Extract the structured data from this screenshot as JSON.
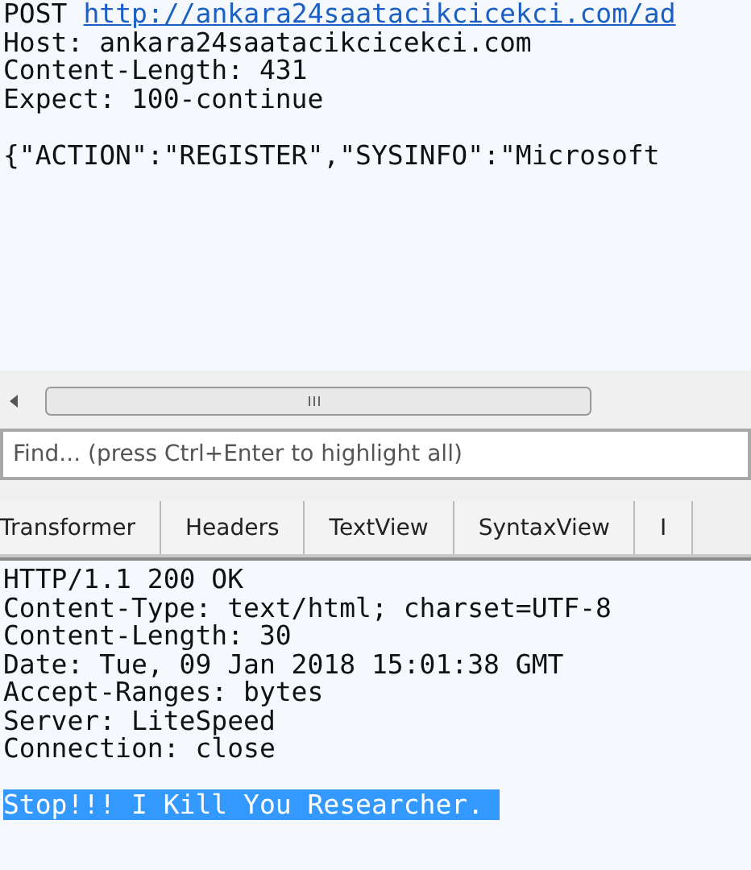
{
  "request": {
    "method": "POST",
    "url": "http://ankara24saatacikcicekci.com/ad",
    "headers": [
      "Host: ankara24saatacikcicekci.com",
      "Content-Length: 431",
      "Expect: 100-continue"
    ],
    "body": "{\"ACTION\":\"REGISTER\",\"SYSINFO\":\"Microsoft"
  },
  "find": {
    "placeholder": "Find... (press Ctrl+Enter to highlight all)"
  },
  "tabs": [
    {
      "label": "Transformer",
      "selected": false
    },
    {
      "label": "Headers",
      "selected": false
    },
    {
      "label": "TextView",
      "selected": false
    },
    {
      "label": "SyntaxView",
      "selected": false
    },
    {
      "label": "I",
      "selected": false
    }
  ],
  "response": {
    "headers": [
      "HTTP/1.1 200 OK",
      "Content-Type: text/html; charset=UTF-8",
      "Content-Length: 30",
      "Date: Tue, 09 Jan 2018 15:01:38 GMT",
      "Accept-Ranges: bytes",
      "Server: LiteSpeed",
      "Connection: close"
    ],
    "body": {
      "text": "Stop!!! I Kill You Researcher. ",
      "selected": true
    }
  }
}
